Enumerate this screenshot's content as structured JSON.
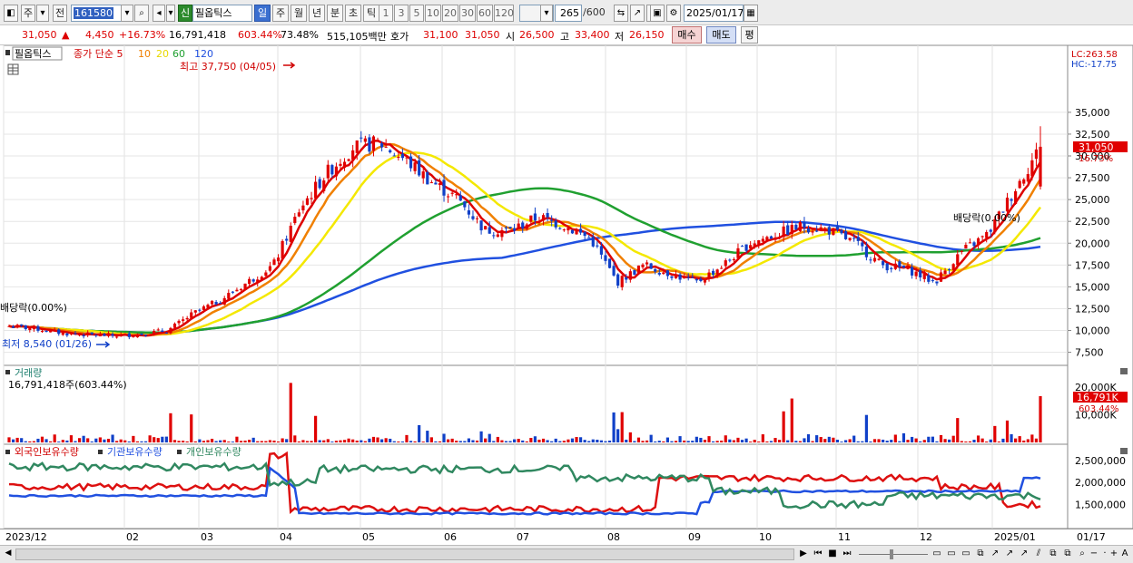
{
  "toolbar": {
    "period_prefix": "주",
    "prev_label": "전",
    "code": "161580",
    "stock_name": "필옵틱스",
    "new_badge": "신",
    "periods": [
      "일",
      "주",
      "월",
      "년",
      "분",
      "초",
      "틱"
    ],
    "selected_period": "일",
    "intervals": [
      "1",
      "3",
      "5",
      "10",
      "20",
      "30",
      "60",
      "120"
    ],
    "count": "265",
    "count_max": "/600",
    "date": "2025/01/17"
  },
  "quote": {
    "price": "31,050",
    "arrow": "▲",
    "change": "4,450",
    "change_pct": "+16.73%",
    "volume": "16,791,418",
    "volume_ratio": "603.44%",
    "turnover_pct": "73.48%",
    "amount": "515,105백만",
    "bid_label": "호가",
    "bid1": "31,100",
    "bid2": "31,050",
    "open_label": "시",
    "open": "26,500",
    "high_label": "고",
    "high": "33,400",
    "low_label": "저",
    "low": "26,150",
    "buy_label": "매수",
    "sell_label": "매도",
    "avg_label": "평"
  },
  "legend": {
    "name": "필옵틱스",
    "ma_title": "종가 단순",
    "periods": [
      "5",
      "10",
      "20",
      "60",
      "120"
    ],
    "colors": [
      "#dd0000",
      "#f08000",
      "#e8d800",
      "#20a030",
      "#2050e0"
    ]
  },
  "annotations": {
    "high": "최고 37,750 (04/05)",
    "low": "최저 8,540 (01/26)",
    "div1": "배당락(0.00%)",
    "div2": "배당락(0.00%)",
    "lc": "LC:263.58",
    "hc": "HC:-17.75",
    "last_price": "31,050",
    "last_pct": "16.73%"
  },
  "price_axis": [
    "35,000",
    "32,500",
    "30,000",
    "27,500",
    "25,000",
    "22,500",
    "20,000",
    "17,500",
    "15,000",
    "12,500",
    "10,000",
    "7,500"
  ],
  "volume_panel": {
    "title": "거래량",
    "value": "16,791,418주(603.44%)",
    "ticks": [
      "20,000K",
      "10,000K"
    ],
    "last": "16,791K",
    "last_pct": "603.44%"
  },
  "holdings_panel": {
    "series": [
      "외국인보유수량",
      "기관보유수량",
      "개인보유수량"
    ],
    "ticks": [
      "2,500,000",
      "2,000,000",
      "1,500,000"
    ]
  },
  "date_axis": [
    "2023/12",
    "02",
    "03",
    "04",
    "05",
    "06",
    "07",
    "08",
    "09",
    "10",
    "11",
    "12",
    "2025/01"
  ],
  "date_axis_right": "01/17",
  "chart_data": [
    {
      "type": "candlestick",
      "title": "필옵틱스",
      "ylim": [
        7000,
        38000
      ],
      "series": [
        {
          "name": "5",
          "values": []
        },
        {
          "name": "10",
          "values": []
        },
        {
          "name": "20",
          "values": []
        },
        {
          "name": "60",
          "values": []
        },
        {
          "name": "120",
          "values": []
        }
      ],
      "x": [
        "2023/12",
        "02",
        "03",
        "04",
        "05",
        "06",
        "07",
        "08",
        "09",
        "10",
        "11",
        "12",
        "2025/01"
      ],
      "close_path": [
        10500,
        10200,
        9700,
        9500,
        9400,
        9600,
        10000,
        12000,
        13500,
        15500,
        17500,
        24000,
        28000,
        31000,
        31500,
        29500,
        27000,
        25000,
        21500,
        21500,
        23000,
        22000,
        20500,
        15500,
        17500,
        16500,
        15500,
        17500,
        20000,
        21000,
        22000,
        21500,
        20000,
        17500,
        17000,
        15500,
        19000,
        21000,
        26000,
        31050
      ]
    },
    {
      "type": "bar",
      "title": "거래량",
      "ylim": [
        0,
        25000
      ],
      "values": [
        16791
      ]
    },
    {
      "type": "line",
      "title": "보유수량",
      "ylim": [
        1000000,
        2700000
      ],
      "series": [
        {
          "name": "외국인보유수량",
          "values": []
        },
        {
          "name": "기관보유수량",
          "values": []
        },
        {
          "name": "개인보유수량",
          "values": []
        }
      ]
    }
  ]
}
